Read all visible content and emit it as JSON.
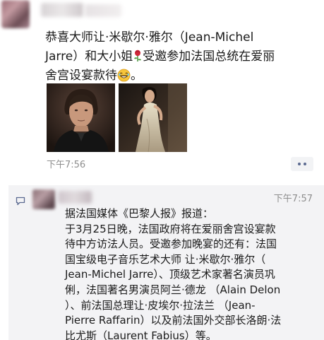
{
  "post": {
    "text_before_rose": "恭喜大师让·米歇尔·雅尔（Jean-Michel\nJarre）和大小姐",
    "text_after_rose": "受邀参加法国总统在爱丽\n舍宫设宴款待",
    "text_end": "。",
    "time": "下午7:56",
    "icons": [
      "rose-icon",
      "laugh-emoji-icon",
      "more-dots-icon"
    ]
  },
  "comment": {
    "time": "下午7:57",
    "text": "据法国媒体《巴黎人报》报道：\n于3月25日晚，法国政府将在爱丽舍宫设宴款\n待中方访法人员。受邀参加晚宴的还有：法国\n国宝级电子音乐艺术大师 让·米歇尔·雅尔（\nJean-Michel Jarre）、顶级艺术家著名演员巩\n俐，法国著名男演员阿兰·德龙 （Alain Delon\n）、前法国总理让·皮埃尔·拉法兰 （Jean-\nPierre Raffarin）以及前法国外交部长洛朗·法\n比尤斯（Laurent Fabius）等。",
    "icons": [
      "comment-bubble-icon"
    ]
  },
  "colors": {
    "link_blue": "#5b6a91",
    "time_gray": "#8e8e8e",
    "comment_bg": "#f3f3f5"
  }
}
